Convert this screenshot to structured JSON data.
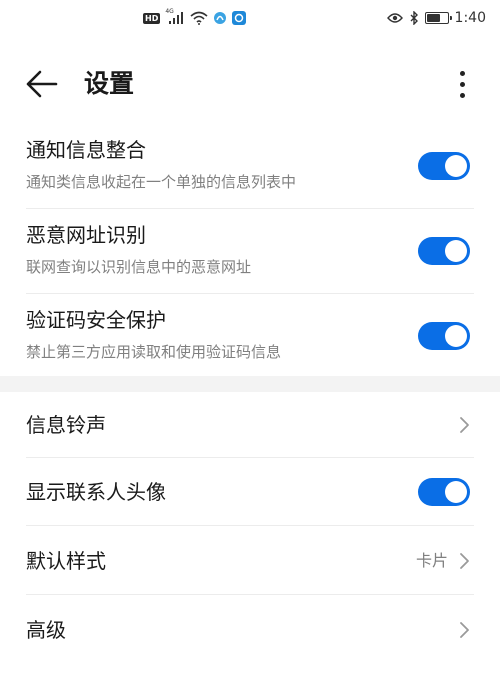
{
  "status_bar": {
    "hd_label": "HD",
    "network_label": "4G",
    "time": "1:40",
    "battery_level": 0.7,
    "icons": [
      "hd-icon",
      "signal-icon",
      "wifi-icon",
      "app-notification-icon",
      "app-notification-icon",
      "eye-icon",
      "bluetooth-icon",
      "battery-icon"
    ]
  },
  "header": {
    "title": "设置",
    "back_icon": "arrow-left-icon",
    "more_icon": "more-vertical-icon"
  },
  "notification_settings": [
    {
      "title": "通知信息整合",
      "description": "通知类信息收起在一个单独的信息列表中",
      "enabled": true
    },
    {
      "title": "恶意网址识别",
      "description": "联网查询以识别信息中的恶意网址",
      "enabled": true
    },
    {
      "title": "验证码安全保护",
      "description": "禁止第三方应用读取和使用验证码信息",
      "enabled": true
    }
  ],
  "general_settings": {
    "ringtone": {
      "title": "信息铃声"
    },
    "show_avatar": {
      "title": "显示联系人头像",
      "enabled": true
    },
    "default_style": {
      "title": "默认样式",
      "value": "卡片"
    },
    "advanced": {
      "title": "高级"
    }
  },
  "colors": {
    "accent": "#0a6ee6",
    "text_primary": "#1a1a1a",
    "text_secondary": "#808080",
    "divider": "#ececec",
    "section_gap": "#f3f3f3"
  }
}
